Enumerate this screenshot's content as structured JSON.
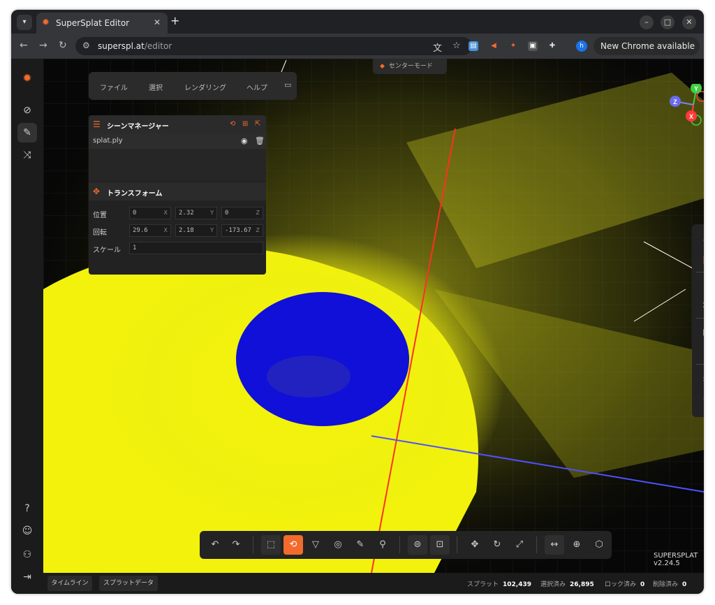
{
  "browser": {
    "tab_title": "SuperSplat Editor",
    "url_host": "superspl.at",
    "url_path": "/editor",
    "update_label": "New Chrome available",
    "profile_initial": "h"
  },
  "menu": {
    "file": "ファイル",
    "select": "選択",
    "render": "レンダリング",
    "help": "ヘルプ"
  },
  "center_mode": "センターモード",
  "scene_manager": {
    "title": "シーンマネージャー",
    "splat_name": "splat.ply"
  },
  "transform": {
    "title": "トランスフォーム",
    "position_label": "位置",
    "rotation_label": "回転",
    "scale_label": "スケール",
    "position": {
      "x": "0",
      "y": "2.32",
      "z": "0"
    },
    "rotation": {
      "x": "29.6",
      "y": "2.18",
      "z": "-173.67"
    },
    "scale": "1",
    "axis_x": "X",
    "axis_y": "Y",
    "axis_z": "Z"
  },
  "gizmo": {
    "x": "X",
    "y": "Y",
    "z": "Z"
  },
  "version": "SUPERSPLAT v2.24.5",
  "status": {
    "timeline_tab": "タイムライン",
    "splat_data_tab": "スプラットデータ",
    "splats_label": "スプラット",
    "splats_value": "102,439",
    "selected_label": "選択済み",
    "selected_value": "26,895",
    "locked_label": "ロック済み",
    "locked_value": "0",
    "deleted_label": "削除済み",
    "deleted_value": "0"
  },
  "colors": {
    "accent": "#f26b2c",
    "splat_yellow": "#f2f20c",
    "selection_blue": "#1010d8",
    "panel_bg": "#222222"
  }
}
